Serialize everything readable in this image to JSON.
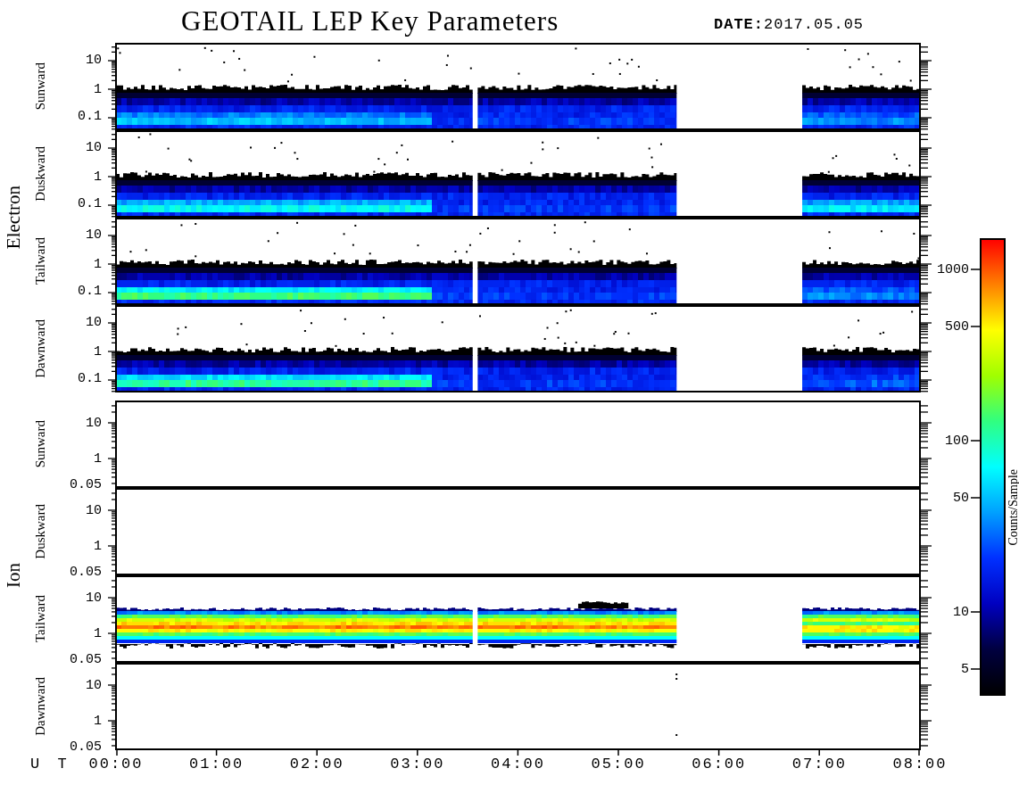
{
  "title": "GEOTAIL LEP Key Parameters",
  "date": "**DATE:**2017.05.05",
  "groups": [
    {
      "name": "Electron",
      "panels": [
        {
          "name": "Sunward",
          "kind": "electron",
          "ticks": [
            "10",
            "1",
            "0.1"
          ]
        },
        {
          "name": "Duskward",
          "kind": "electron",
          "ticks": [
            "10",
            "1",
            "0.1"
          ]
        },
        {
          "name": "Tailward",
          "kind": "electron",
          "ticks": [
            "10",
            "1",
            "0.1"
          ]
        },
        {
          "name": "Dawnward",
          "kind": "electron",
          "ticks": [
            "10",
            "1",
            "0.1"
          ]
        }
      ]
    },
    {
      "name": "Ion",
      "panels": [
        {
          "name": "Sunward",
          "kind": "empty",
          "ticks": [
            "10",
            "1",
            "0.05"
          ]
        },
        {
          "name": "Duskward",
          "kind": "empty",
          "ticks": [
            "10",
            "1",
            "0.05"
          ]
        },
        {
          "name": "Tailward",
          "kind": "ion",
          "ticks": [
            "10",
            "1",
            "0.05"
          ]
        },
        {
          "name": "Dawnward",
          "kind": "sparse",
          "ticks": [
            "10",
            "1",
            "0.05"
          ]
        }
      ]
    }
  ],
  "time_axis": {
    "label": "U T",
    "ticks": [
      "00:00",
      "01:00",
      "02:00",
      "03:00",
      "04:00",
      "05:00",
      "06:00",
      "07:00",
      "08:00"
    ]
  },
  "colorbar": {
    "title": "Counts/Sample",
    "ticks": [
      "1000",
      "500",
      "100",
      "50",
      "10",
      "5"
    ]
  }
}
